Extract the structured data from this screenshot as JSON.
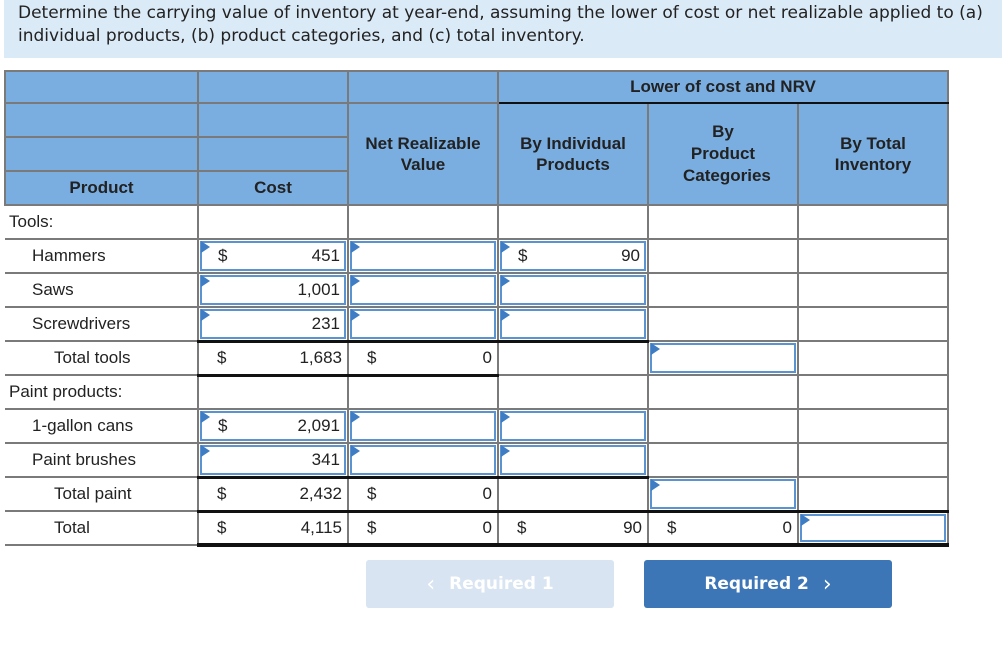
{
  "instructions": "Determine the carrying value of inventory at year-end, assuming the lower of cost or net realizable applied to (a) individual products, (b) product categories, and (c) total inventory.",
  "table": {
    "group_header": "Lower of cost and NRV",
    "headers": {
      "product": "Product",
      "cost": "Cost",
      "nrv": "Net Realizable Value",
      "by_individual": "By Individual Products",
      "by_category": "By Product Categories",
      "by_total": "By Total Inventory"
    },
    "rows": [
      {
        "label": "Tools:",
        "type": "section"
      },
      {
        "label": "Hammers",
        "cost": "451",
        "cost_dollar": "$",
        "nrv": "",
        "individual": "90",
        "individual_dollar": "$"
      },
      {
        "label": "Saws",
        "cost": "1,001",
        "nrv": "",
        "individual": ""
      },
      {
        "label": "Screwdrivers",
        "cost": "231",
        "nrv": "",
        "individual": ""
      },
      {
        "label": "Total tools",
        "cost": "1,683",
        "cost_dollar": "$",
        "nrv": "0",
        "nrv_dollar": "$",
        "category": ""
      },
      {
        "label": "Paint products:",
        "type": "section"
      },
      {
        "label": "1-gallon cans",
        "cost": "2,091",
        "cost_dollar": "$",
        "nrv": "",
        "individual": ""
      },
      {
        "label": "Paint brushes",
        "cost": "341",
        "nrv": "",
        "individual": ""
      },
      {
        "label": "Total paint",
        "cost": "2,432",
        "cost_dollar": "$",
        "nrv": "0",
        "nrv_dollar": "$",
        "category": ""
      },
      {
        "label": "Total",
        "cost": "4,115",
        "cost_dollar": "$",
        "nrv": "0",
        "nrv_dollar": "$",
        "individual": "90",
        "individual_dollar": "$",
        "category": "0",
        "category_dollar": "$",
        "total": ""
      }
    ]
  },
  "buttons": {
    "prev": "Required 1",
    "next": "Required 2",
    "prev_icon": "chevron-left-icon",
    "next_icon": "chevron-right-icon"
  }
}
